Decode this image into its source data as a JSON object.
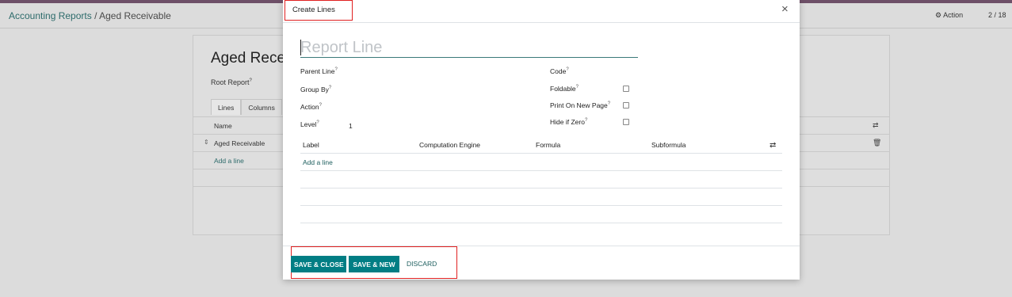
{
  "breadcrumb": {
    "parent": "Accounting Reports",
    "separator": "/",
    "current": "Aged Receivable"
  },
  "control_panel": {
    "action_label": "Action",
    "pager": "2 / 18"
  },
  "background_form": {
    "title": "Aged Rece",
    "root_report_label": "Root Report",
    "help_mark": "?",
    "tabs": [
      "Lines",
      "Columns"
    ],
    "table_header": "Name",
    "rows": [
      "Aged Receivable"
    ],
    "add_line": "Add a line"
  },
  "modal": {
    "title": "Create Lines",
    "close_glyph": "×",
    "name_placeholder": "Report Line",
    "help_mark": "?",
    "left_fields": [
      {
        "label": "Parent Line",
        "value": ""
      },
      {
        "label": "Group By",
        "value": ""
      },
      {
        "label": "Action",
        "value": ""
      },
      {
        "label": "Level",
        "value": "1"
      }
    ],
    "right_fields": [
      {
        "label": "Code"
      },
      {
        "label": "Foldable",
        "checked": false
      },
      {
        "label": "Print On New Page",
        "checked": false
      },
      {
        "label": "Hide if Zero",
        "checked": false
      }
    ],
    "lines_table": {
      "columns": [
        "Label",
        "Computation Engine",
        "Formula",
        "Subformula"
      ],
      "add_line": "Add a line"
    },
    "footer": {
      "save_close": "SAVE & CLOSE",
      "save_new": "SAVE & NEW",
      "discard": "DISCARD"
    }
  },
  "colors": {
    "primary": "#017e84",
    "link": "#1d5e5e",
    "highlight_box": "#e02020",
    "topbar": "#6e5068"
  }
}
